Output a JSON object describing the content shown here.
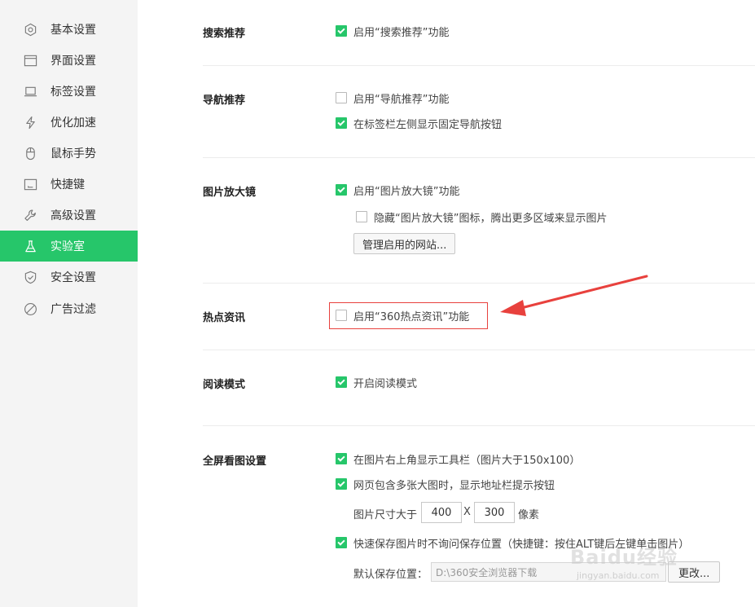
{
  "sidebar": {
    "items": [
      {
        "label": "基本设置",
        "icon": "gear-icon"
      },
      {
        "label": "界面设置",
        "icon": "window-icon"
      },
      {
        "label": "标签设置",
        "icon": "tab-icon"
      },
      {
        "label": "优化加速",
        "icon": "lightning-icon"
      },
      {
        "label": "鼠标手势",
        "icon": "mouse-icon"
      },
      {
        "label": "快捷键",
        "icon": "keyboard-icon"
      },
      {
        "label": "高级设置",
        "icon": "wrench-icon"
      },
      {
        "label": "实验室",
        "icon": "flask-icon",
        "active": true
      },
      {
        "label": "安全设置",
        "icon": "shield-icon"
      },
      {
        "label": "广告过滤",
        "icon": "block-icon"
      }
    ]
  },
  "sections": {
    "search": {
      "title": "搜索推荐",
      "opt1": {
        "label": "启用“搜索推荐”功能",
        "checked": true
      }
    },
    "nav": {
      "title": "导航推荐",
      "opt1": {
        "label": "启用“导航推荐”功能",
        "checked": false
      },
      "opt2": {
        "label": "在标签栏左侧显示固定导航按钮",
        "checked": true
      }
    },
    "magnifier": {
      "title": "图片放大镜",
      "opt1": {
        "label": "启用“图片放大镜”功能",
        "checked": true
      },
      "opt2": {
        "label": "隐藏“图片放大镜”图标，腾出更多区域来显示图片",
        "checked": false
      },
      "manage_button": "管理启用的网站..."
    },
    "hotnews": {
      "title": "热点资讯",
      "opt1": {
        "label": "启用“360热点资讯”功能",
        "checked": false
      }
    },
    "reading": {
      "title": "阅读模式",
      "opt1": {
        "label": "开启阅读模式",
        "checked": true
      }
    },
    "fullscreen": {
      "title": "全屏看图设置",
      "opt1": {
        "label": "在图片右上角显示工具栏（图片大于150x100）",
        "checked": true
      },
      "opt2": {
        "label": "网页包含多张大图时，显示地址栏提示按钮",
        "checked": true
      },
      "size_label": "图片尺寸大于",
      "size_w": "400",
      "size_x": "X",
      "size_h": "300",
      "size_unit": "像素",
      "opt3": {
        "label": "快速保存图片时不询问保存位置（快捷键：按住ALT键后左键单击图片）",
        "checked": true
      },
      "save_label": "默认保存位置：",
      "save_path": "D:\\360安全浏览器下载",
      "change_button": "更改..."
    }
  },
  "watermark": {
    "logo": "Baidu经验",
    "url": "jingyan.baidu.com"
  },
  "colors": {
    "accent": "#26c66a",
    "annotation": "#e8413d",
    "sidebar_bg": "#f4f4f4"
  }
}
